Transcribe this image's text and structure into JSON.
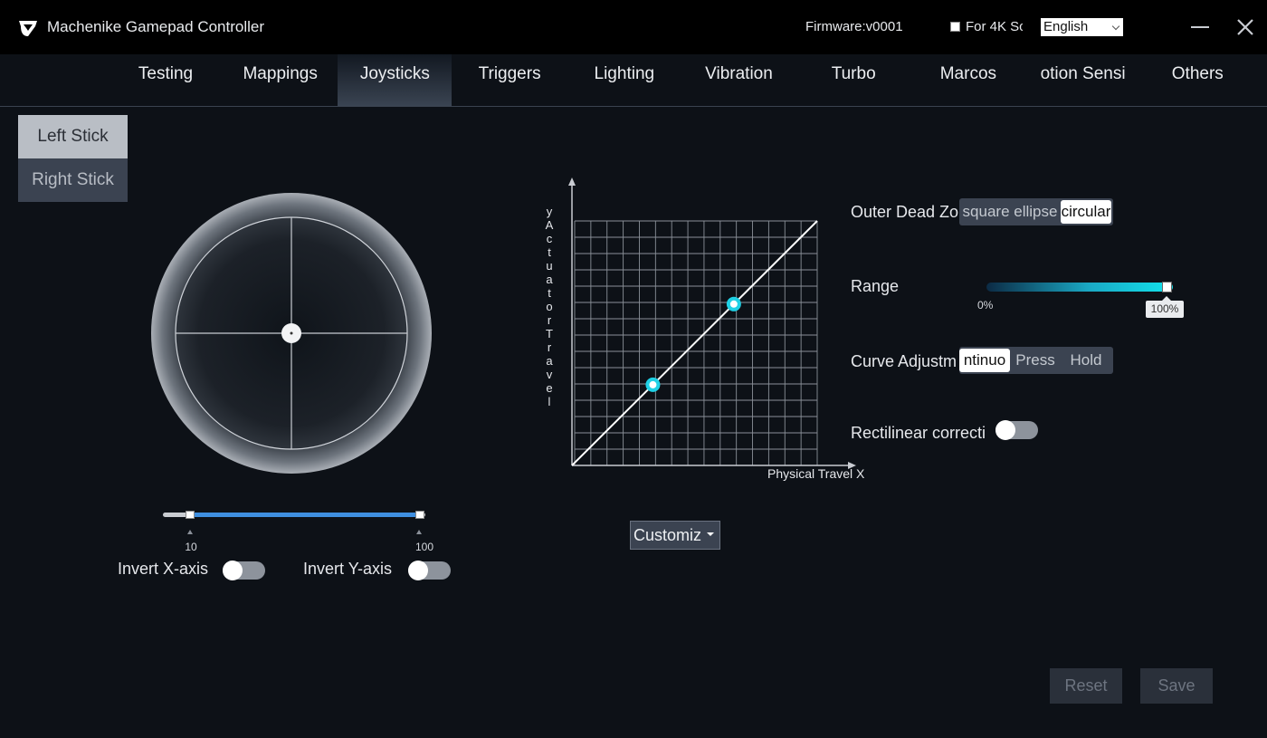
{
  "app": {
    "title": "Machenike Gamepad Controller",
    "firmware": "Firmware:v0001",
    "fourk_label": "For 4K Sc",
    "language": "English"
  },
  "tabs": [
    {
      "label": "Testing"
    },
    {
      "label": "Mappings"
    },
    {
      "label": "Joysticks",
      "active": true
    },
    {
      "label": "Triggers"
    },
    {
      "label": "Lighting"
    },
    {
      "label": "Vibration"
    },
    {
      "label": "Turbo"
    },
    {
      "label": "Marcos"
    },
    {
      "label": "otion Sensi"
    },
    {
      "label": "Others"
    }
  ],
  "stick_selector": {
    "left": "Left Stick",
    "right": "Right Stick",
    "selected": "left"
  },
  "deadzone": {
    "min_label": "10",
    "max_label": "100",
    "min_value": 10,
    "max_value": 100
  },
  "invert": {
    "x_label": "Invert X-axis",
    "y_label": "Invert Y-axis",
    "x_on": false,
    "y_on": false
  },
  "curve": {
    "y_label": "yActuatorTravel",
    "x_label": "Physical Travel X",
    "points": [
      [
        0.33,
        0.33
      ],
      [
        0.66,
        0.66
      ]
    ],
    "line_color": "#ffffff",
    "point_color": "#1fd1e6"
  },
  "preset": {
    "value": "Customiz"
  },
  "outer_dead_zone": {
    "label": "Outer Dead Zo",
    "options": [
      "square ellipse",
      "circular"
    ],
    "selected": "circular"
  },
  "range": {
    "label": "Range",
    "min_label": "0%",
    "max_label": "100%",
    "value_percent": 100
  },
  "curve_adjustment": {
    "label": "Curve Adjustm",
    "options": [
      "ntinuo",
      "Press",
      "Hold"
    ],
    "selected": "ntinuo"
  },
  "rectilinear": {
    "label": "Rectilinear correcti",
    "on": false
  },
  "buttons": {
    "reset": "Reset",
    "save": "Save"
  },
  "colors": {
    "background": "#0d1117",
    "titlebar": "#000000",
    "accent": "#1fd1e6",
    "slider_fill": "#3f8fe0"
  }
}
